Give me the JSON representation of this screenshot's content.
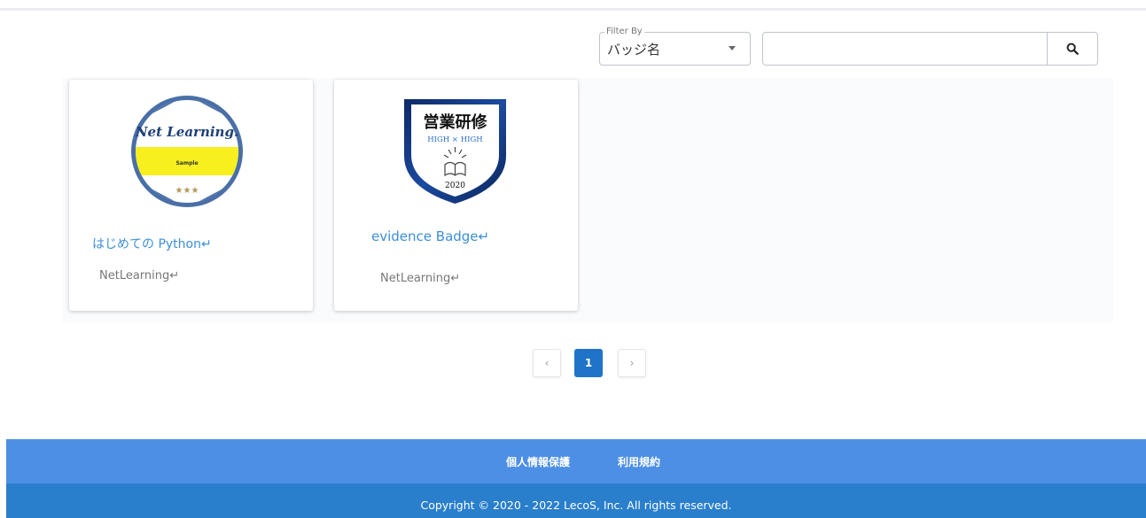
{
  "filter": {
    "legend": "Filter By",
    "selected": "バッジ名"
  },
  "search": {
    "value": "",
    "placeholder": ""
  },
  "cards": [
    {
      "title": "はじめての Python↵",
      "issuer": "NetLearning↵",
      "badge": {
        "logo": "Net Learning.",
        "band_text": "Sample",
        "stars": "★★★",
        "colors": {
          "ring": "#4a6fa8",
          "band": "#f7ef1e",
          "logo": "#1e3f78"
        }
      }
    },
    {
      "title": "evidence Badge↵",
      "issuer": "NetLearning↵",
      "badge": {
        "heading": "営業研修",
        "subheading": "HIGH × HIGH",
        "year": "2020",
        "colors": {
          "border": "#1a3f80",
          "background": "#ffffff"
        }
      }
    }
  ],
  "pagination": {
    "prev_label": "‹",
    "current": "1",
    "next_label": "›"
  },
  "footer": {
    "privacy_label": "個人情報保護",
    "terms_label": "利用規約",
    "copyright": "Copyright © 2020 - 2022 LecoS, Inc. All rights reserved."
  },
  "colors": {
    "accent": "#1f74c9",
    "footer_top": "#4d8fe5",
    "footer_bottom": "#2a7fcc",
    "link": "#3c8fd9"
  }
}
